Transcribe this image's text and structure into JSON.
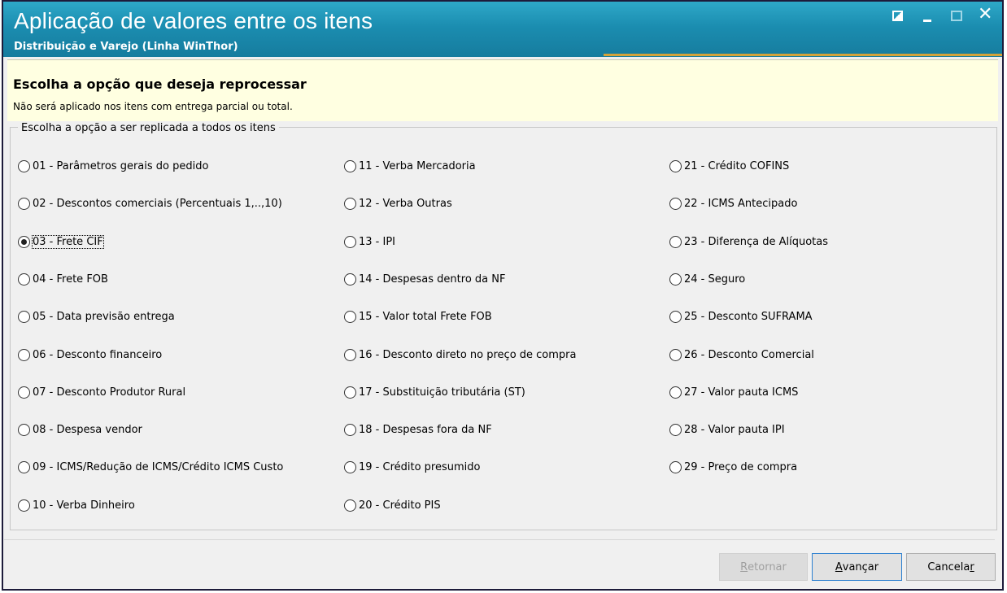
{
  "window": {
    "title": "Aplicação de valores entre os itens",
    "subtitle": "Distribuição e Varejo (Linha WinThor)"
  },
  "header": {
    "heading": "Escolha a opção que deseja reprocessar",
    "note": "Não será aplicado nos itens com entrega parcial ou total."
  },
  "group": {
    "caption": "Escolha a opção a ser replicada a todos os itens",
    "selected": "03 - Frete CIF",
    "columns": [
      [
        "01 - Parâmetros gerais do pedido",
        "02 - Descontos comerciais (Percentuais 1,..,10)",
        "03 - Frete CIF",
        "04 - Frete FOB",
        "05 - Data previsão entrega",
        "06 - Desconto financeiro",
        "07 - Desconto Produtor Rural",
        "08 - Despesa vendor",
        "09 - ICMS/Redução de ICMS/Crédito ICMS Custo",
        "10 - Verba Dinheiro"
      ],
      [
        "11 - Verba Mercadoria",
        "12 - Verba Outras",
        "13 - IPI",
        "14 - Despesas dentro da NF",
        "15 - Valor total Frete FOB",
        "16 - Desconto direto no preço de compra",
        "17 - Substituição tributária (ST)",
        "18 - Despesas fora da NF",
        "19 - Crédito presumido",
        "20 - Crédito PIS"
      ],
      [
        "21 - Crédito COFINS",
        "22 - ICMS Antecipado",
        "23 - Diferença de Alíquotas",
        "24 - Seguro",
        "25 - Desconto SUFRAMA",
        "26 - Desconto Comercial",
        "27 - Valor pauta ICMS",
        "28 - Valor pauta IPI",
        "29 - Preço de compra"
      ]
    ]
  },
  "buttons": {
    "back": {
      "first": "R",
      "rest": "etornar"
    },
    "next": {
      "first": "A",
      "rest": "vançar"
    },
    "cancel": {
      "first": "Cancela",
      "u": "r"
    }
  }
}
